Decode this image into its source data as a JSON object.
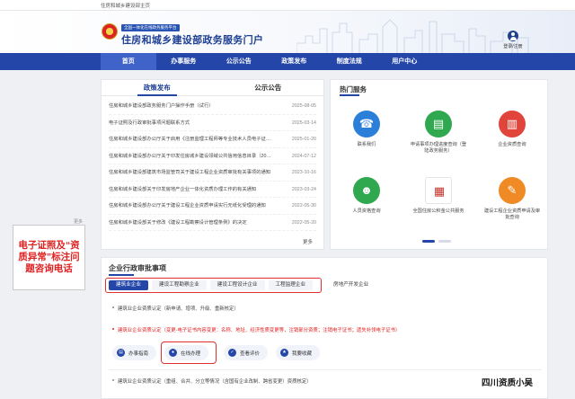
{
  "topbar": {
    "text": "住房和城乡建设部主页"
  },
  "header": {
    "badge": "全国一体化在线政务服务平台",
    "title": "住房和城乡建设部政务服务门户",
    "login_label": "登录/注册"
  },
  "nav": {
    "items": [
      {
        "label": "首页"
      },
      {
        "label": "办事服务"
      },
      {
        "label": "公示公告"
      },
      {
        "label": "政策发布"
      },
      {
        "label": "制度法规"
      },
      {
        "label": "用户中心"
      }
    ]
  },
  "policy": {
    "tabs": [
      {
        "label": "政策发布"
      },
      {
        "label": "公示公告"
      }
    ],
    "items": [
      {
        "title": "住房和城乡建设部政务服务门户操作手册（试行）",
        "date": "2025-08-05"
      },
      {
        "title": "电子证照及行政审批事项问题联系方式",
        "date": "2025-03-14"
      },
      {
        "title": "住房和城乡建设部办公厅关于启用《注册监理工程师等专业技术人员电子证书》的通知",
        "date": "2025-01-20"
      },
      {
        "title": "住房和城乡建设部办公厅关于印发住房城乡建设领域公共信用信息目录（2024年版）的通知",
        "date": "2024-07-12"
      },
      {
        "title": "住房和城乡建设部建筑市场监管司关于建设工程企业资质审批有关事项的通知",
        "date": "2023-10-16"
      },
      {
        "title": "住房和城乡建设部关于印发房地产企业一体化资质办理工作的有关通知",
        "date": "2023-03-24"
      },
      {
        "title": "住房和城乡建设部办公厅关于建设工程企业资质申请实行无纸化受理的通知",
        "date": "2022-05-30"
      },
      {
        "title": "住房和城乡建设部关于修改《建设工程勘察设计管理条例》的决定",
        "date": "2022-05-20"
      }
    ],
    "more": "更多"
  },
  "hot": {
    "title": "热门服务",
    "services": [
      {
        "label": "联系我们",
        "color": "#2b7fd8",
        "icon": "phone-icon"
      },
      {
        "label": "申请事项办理进度查询（登陆政务服务）",
        "color": "#2fa84f",
        "icon": "document-icon"
      },
      {
        "label": "企业资质查询",
        "color": "#e0443a",
        "icon": "building-icon"
      },
      {
        "label": "人员资格查询",
        "color": "#2fa84f",
        "icon": "worker-icon"
      },
      {
        "label": "全国住房公积金公共服务",
        "color": "#c0342c",
        "icon": "fund-logo-icon"
      },
      {
        "label": "建设工程企业资质申请及审批查询",
        "color": "#f08a24",
        "icon": "approval-icon"
      }
    ]
  },
  "callout": {
    "text": "电子证照及“资质异常”标注问题咨询电话"
  },
  "side_label": "更多",
  "approval": {
    "title": "企业行政审批事项",
    "subtabs": [
      {
        "label": "建筑业企业"
      },
      {
        "label": "建设工程勘察企业"
      },
      {
        "label": "建设工程设计企业"
      },
      {
        "label": "工程监理企业"
      }
    ],
    "extra_tab": "房地产开发企业",
    "items": [
      {
        "text": "建筑业企业资质认定（新申请、增项、升级、重新核定）",
        "red": false
      },
      {
        "text": "建筑业企业资质认定（变更-电子证书内容变更：名称、地址、经济性质变更等，注销部分资质；注销电子证书；遗失补领电子证书）",
        "red": true
      },
      {
        "text": "建筑业企业资质认定（重组、合并、分立等情况（含国有企业改制、跨省变更）资质核定）",
        "red": false
      }
    ],
    "actions": [
      {
        "label": "办事指南",
        "icon": "guide-icon"
      },
      {
        "label": "在线办理",
        "icon": "user-icon"
      },
      {
        "label": "查看评价",
        "icon": "review-icon"
      },
      {
        "label": "我要收藏",
        "icon": "star-icon"
      }
    ]
  },
  "watermark": "四川资质小吴"
}
